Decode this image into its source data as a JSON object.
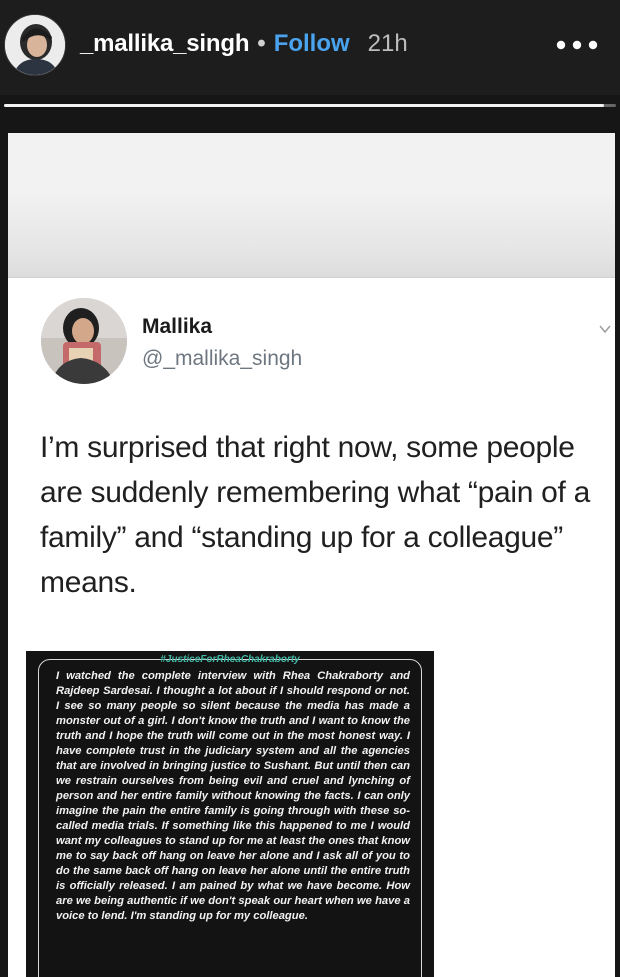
{
  "story": {
    "username": "_mallika_singh",
    "separator": "•",
    "follow_label": "Follow",
    "time": "21h",
    "progress": 0.98,
    "more_icon": "more-horizontal-icon"
  },
  "tweet": {
    "name": "Mallika",
    "handle": "@_mallika_singh",
    "text": "I’m surprised that right now, some people are suddenly remembering what “pain of a family” and “standing up for a colleague” means."
  },
  "note": {
    "hashtag": "#JusticeForRheaChakraborty",
    "body": "I watched the complete interview with Rhea Chakraborty and Rajdeep Sardesai. I thought a lot about if I should respond or not. I see so many people so silent because the media has made a monster out of a girl. I don't know the truth and I want to know the truth and I hope the truth will come out in the most honest way. I have complete trust in the judiciary system and all the agencies that are involved in bringing justice to Sushant. But until then can we restrain ourselves from being evil and cruel and lynching of person and her entire family without knowing the facts. I can only imagine the pain the entire family is going through with these so-called media trials. If something like this happened to me I would want my colleagues to stand up for me at least the ones that know me to say back off hang on leave her alone and I ask all of you to do the same back off hang on leave her alone until the entire truth is officially released. I am pained by what we have become. How are we being authentic if we don't speak our heart when we have a voice to lend. I'm standing up for my colleague."
  },
  "colors": {
    "follow": "#4aa3ee",
    "header_bg": "#1d1d1d",
    "hashtag": "#40b8a4"
  }
}
